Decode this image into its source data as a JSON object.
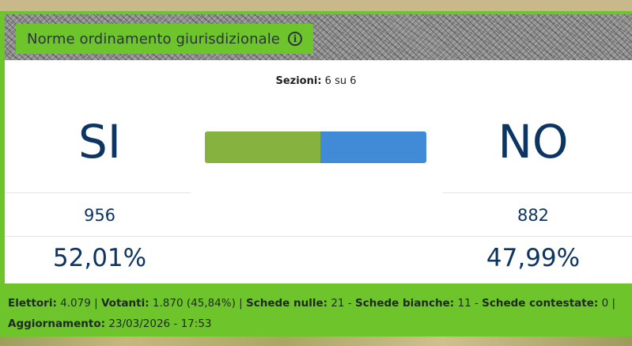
{
  "title": "Norme ordinamento giurisdizionale",
  "info_icon": "info-circle-icon",
  "sezioni": {
    "label": "Sezioni:",
    "value": "6 su 6"
  },
  "yes": {
    "label": "SI",
    "votes": "956",
    "percent": "52,01%",
    "share": 0.5201,
    "color": "#86b340"
  },
  "no": {
    "label": "NO",
    "votes": "882",
    "percent": "47,99%",
    "share": 0.4799,
    "color": "#418bd6"
  },
  "footer": {
    "elettori_label": "Elettori:",
    "elettori_value": "4.079",
    "votanti_label": "Votanti:",
    "votanti_value": "1.870 (45,84%)",
    "nulle_label": "Schede nulle:",
    "nulle_value": "21",
    "bianche_label": "Schede bianche:",
    "bianche_value": "11",
    "contestate_label": "Schede contestate:",
    "contestate_value": "0",
    "aggiornamento_label": "Aggiornamento:",
    "aggiornamento_value": "23/03/2026 - 17:53"
  },
  "colors": {
    "accent": "#6dc52b",
    "text_dark": "#0d3563"
  }
}
